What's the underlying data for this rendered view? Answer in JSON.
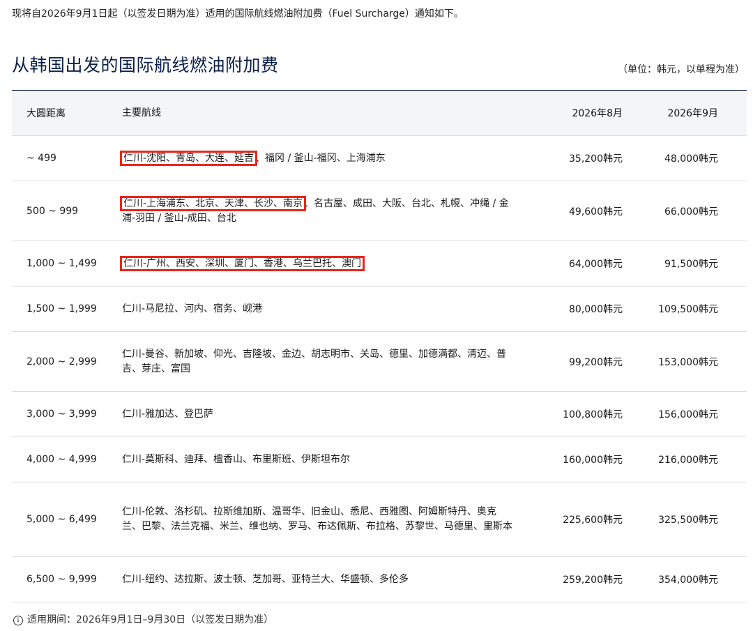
{
  "notice": "现将自2026年9月1日起（以签发日期为准）适用的国际航线燃油附加费（Fuel Surcharge）通知如下。",
  "title": "从韩国出发的国际航线燃油附加费",
  "unit_note": "（单位：韩元，以单程为准）",
  "headers": {
    "distance": "大圆距离",
    "routes": "主要航线",
    "aug": "2026年8月",
    "sep": "2026年9月"
  },
  "rows": [
    {
      "distance": "~ 499",
      "route_highlight": "仁川-沈阳、青岛、大连、延吉",
      "route_rest": "、福冈 / 釜山-福冈、上海浦东",
      "aug": "35,200韩元",
      "sep": "48,000韩元"
    },
    {
      "distance": "500 ~ 999",
      "route_highlight": "仁川-上海浦东、北京、天津、长沙、南京",
      "route_rest": "、名古屋、成田、大阪、台北、札幌、冲绳 / 金浦-羽田 / 釜山-成田、台北",
      "aug": "49,600韩元",
      "sep": "66,000韩元"
    },
    {
      "distance": "1,000 ~ 1,499",
      "route_highlight": "仁川-广州、西安、深圳、厦门、香港、乌兰巴托、澳门",
      "route_rest": "",
      "aug": "64,000韩元",
      "sep": "91,500韩元"
    },
    {
      "distance": "1,500 ~ 1,999",
      "route_highlight": "",
      "route_rest": "仁川-马尼拉、河内、宿务、岘港",
      "aug": "80,000韩元",
      "sep": "109,500韩元"
    },
    {
      "distance": "2,000 ~ 2,999",
      "route_highlight": "",
      "route_rest": "仁川-曼谷、新加坡、仰光、吉隆坡、金边、胡志明市、关岛、德里、加德满都、清迈、普吉、芽庄、富国",
      "aug": "99,200韩元",
      "sep": "153,000韩元"
    },
    {
      "distance": "3,000 ~ 3,999",
      "route_highlight": "",
      "route_rest": "仁川-雅加达、登巴萨",
      "aug": "100,800韩元",
      "sep": "156,000韩元"
    },
    {
      "distance": "4,000 ~ 4,999",
      "route_highlight": "",
      "route_rest": "仁川-莫斯科、迪拜、檀香山、布里斯班、伊斯坦布尔",
      "aug": "160,000韩元",
      "sep": "216,000韩元"
    },
    {
      "distance": "5,000 ~ 6,499",
      "route_highlight": "",
      "route_rest": "仁川-伦敦、洛杉矶、拉斯维加斯、温哥华、旧金山、悉尼、西雅图、阿姆斯特丹、奥克兰、巴黎、法兰克福、米兰、维也纳、罗马、布达佩斯、布拉格、苏黎世、马德里、里斯本",
      "aug": "225,600韩元",
      "sep": "325,500韩元"
    },
    {
      "distance": "6,500 ~ 9,999",
      "route_highlight": "",
      "route_rest": "仁川-纽约、达拉斯、波士顿、芝加哥、亚特兰大、华盛顿、多伦多",
      "aug": "259,200韩元",
      "sep": "354,000韩元"
    }
  ],
  "footnote_icon": "info-icon",
  "footnote": "适用期间：2026年9月1日–9月30日（以签发日期为准）",
  "colors": {
    "title": "#0b1f4a",
    "highlight_border": "#e8261b",
    "header_bg": "#f4f5f7"
  }
}
